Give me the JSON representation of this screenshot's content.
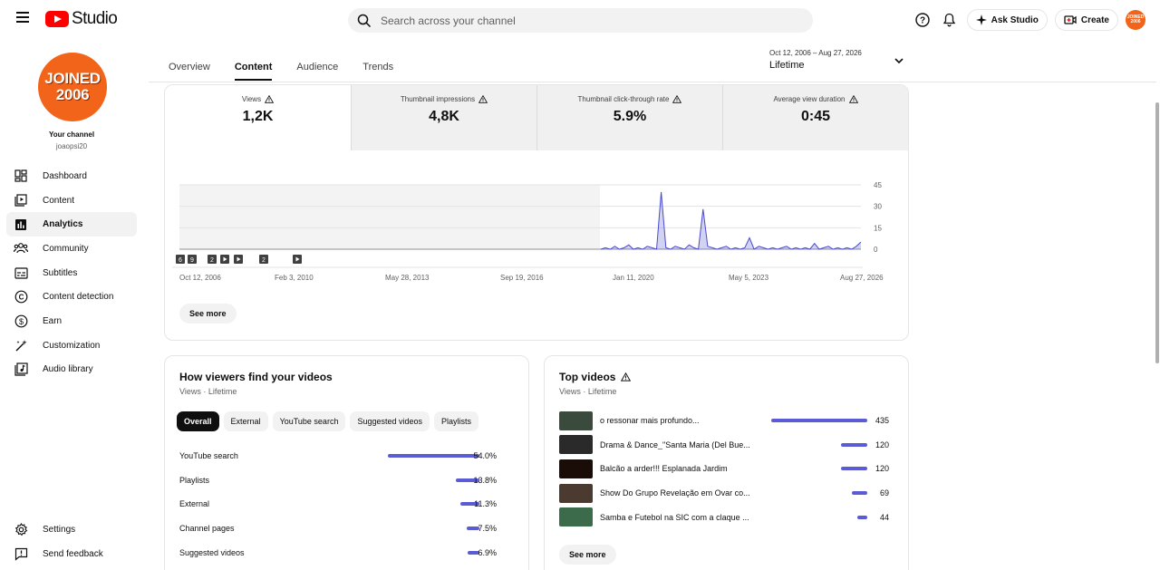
{
  "header": {
    "logo_text": "Studio",
    "search_placeholder": "Search across your channel",
    "ask_studio": "Ask Studio",
    "create": "Create",
    "avatar_text": "JOINED 2006"
  },
  "sidebar": {
    "avatar_line1": "JOINED",
    "avatar_line2": "2006",
    "your_channel": "Your channel",
    "handle": "joaopsi20",
    "items": [
      {
        "label": "Dashboard",
        "icon": "dashboard-icon"
      },
      {
        "label": "Content",
        "icon": "content-icon"
      },
      {
        "label": "Analytics",
        "icon": "analytics-icon",
        "active": true
      },
      {
        "label": "Community",
        "icon": "community-icon"
      },
      {
        "label": "Subtitles",
        "icon": "subtitles-icon"
      },
      {
        "label": "Content detection",
        "icon": "content-detection-icon"
      },
      {
        "label": "Earn",
        "icon": "earn-icon"
      },
      {
        "label": "Customization",
        "icon": "customization-icon"
      },
      {
        "label": "Audio library",
        "icon": "audio-library-icon"
      }
    ],
    "settings": "Settings",
    "feedback": "Send feedback"
  },
  "tabs": [
    "Overview",
    "Content",
    "Audience",
    "Trends"
  ],
  "active_tab": "Content",
  "date_range": {
    "dates": "Oct 12, 2006 – Aug 27, 2026",
    "period": "Lifetime"
  },
  "metrics": [
    {
      "label": "Views",
      "value": "1,2K"
    },
    {
      "label": "Thumbnail impressions",
      "value": "4,8K"
    },
    {
      "label": "Thumbnail click-through rate",
      "value": "5.9%"
    },
    {
      "label": "Average view duration",
      "value": "0:45"
    }
  ],
  "chart_data": {
    "type": "line",
    "series": [
      {
        "values": [
          0,
          1,
          0,
          2,
          0,
          1,
          3,
          0,
          1,
          0,
          2,
          1,
          0,
          40,
          1,
          0,
          2,
          1,
          0,
          3,
          1,
          0,
          28,
          2,
          1,
          0,
          1,
          2,
          0,
          1,
          0,
          1,
          8,
          0,
          2,
          1,
          0,
          1,
          0,
          1,
          2,
          0,
          1,
          0,
          1,
          0,
          4,
          0,
          1,
          2,
          0,
          1,
          0,
          1,
          0,
          2,
          5
        ]
      }
    ],
    "x_tick_labels": [
      "Oct 12, 2006",
      "Feb 3, 2010",
      "May 28, 2013",
      "Sep 19, 2016",
      "Jan 11, 2020",
      "May 5, 2023",
      "Aug 27, 2026"
    ],
    "y_tick_labels": [
      "45",
      "30",
      "15",
      "0"
    ],
    "ylim": [
      0,
      45
    ],
    "marker_labels": [
      "6",
      "9",
      "2",
      "2"
    ],
    "grid": true
  },
  "see_more": "See more",
  "traffic": {
    "title": "How viewers find your videos",
    "subtitle": "Views · Lifetime",
    "chips": [
      "Overall",
      "External",
      "YouTube search",
      "Suggested videos",
      "Playlists"
    ],
    "rows": [
      {
        "label": "YouTube search",
        "pct": "54.0%",
        "value": 54.0
      },
      {
        "label": "Playlists",
        "pct": "13.8%",
        "value": 13.8
      },
      {
        "label": "External",
        "pct": "11.3%",
        "value": 11.3
      },
      {
        "label": "Channel pages",
        "pct": "7.5%",
        "value": 7.5
      },
      {
        "label": "Suggested videos",
        "pct": "6.9%",
        "value": 6.9
      }
    ]
  },
  "top_videos": {
    "title": "Top videos",
    "subtitle": "Views · Lifetime",
    "rows": [
      {
        "title": "o ressonar mais profundo...",
        "views": "435",
        "value": 435,
        "thumb": "#3a4a3c"
      },
      {
        "title": "Drama & Dance_\"Santa Maria (Del Bue...",
        "views": "120",
        "value": 120,
        "thumb": "#2a2a2a"
      },
      {
        "title": "Balcão a arder!!! Esplanada Jardim",
        "views": "120",
        "value": 120,
        "thumb": "#1a0d08"
      },
      {
        "title": "Show Do Grupo Revelação em Ovar co...",
        "views": "69",
        "value": 69,
        "thumb": "#4a3a30"
      },
      {
        "title": "Samba e Futebol na SIC com a claque ...",
        "views": "44",
        "value": 44,
        "thumb": "#3b6b4a"
      }
    ],
    "see_more": "See more"
  }
}
